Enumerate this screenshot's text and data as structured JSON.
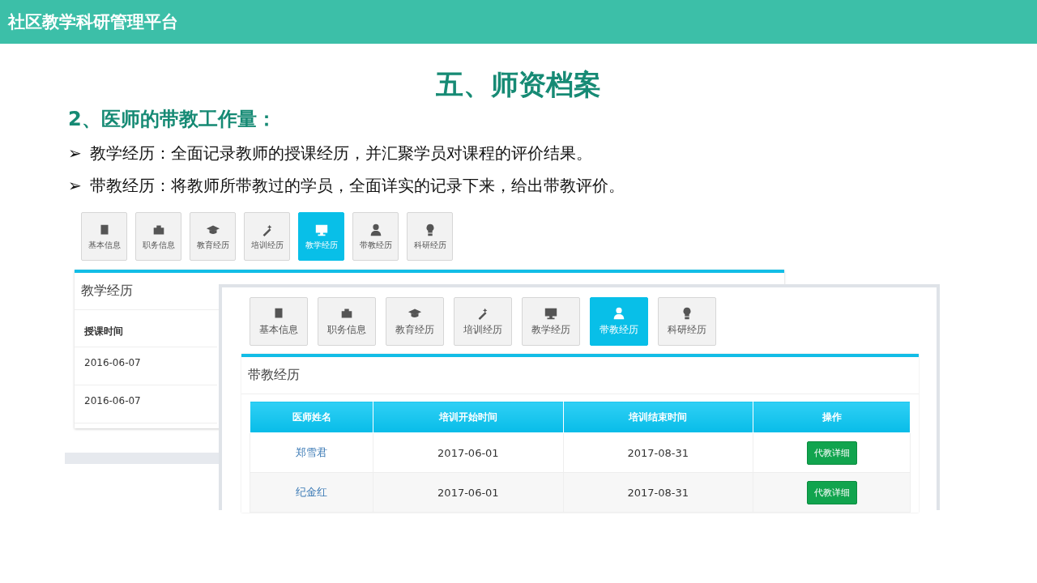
{
  "header": {
    "title": "社区教学科研管理平台"
  },
  "slide": {
    "title": "五、师资档案",
    "subtitle": "2、医师的带教工作量：",
    "bullets": [
      {
        "marker": "➢",
        "text": "教学经历：全面记录教师的授课经历，并汇聚学员对课程的评价结果。"
      },
      {
        "marker": "➢",
        "text": "带教经历：将教师所带教过的学员，全面详实的记录下来，给出带教评价。"
      }
    ]
  },
  "back_screen": {
    "tabs": [
      {
        "label": "基本信息",
        "selected": false
      },
      {
        "label": "职务信息",
        "selected": false
      },
      {
        "label": "教育经历",
        "selected": false
      },
      {
        "label": "培训经历",
        "selected": false
      },
      {
        "label": "教学经历",
        "selected": true
      },
      {
        "label": "带教经历",
        "selected": false
      },
      {
        "label": "科研经历",
        "selected": false
      }
    ],
    "panel_title": "教学经历",
    "column": "授课时间",
    "rows": [
      "2016-06-07",
      "2016-06-07"
    ]
  },
  "front_screen": {
    "tabs": [
      {
        "label": "基本信息",
        "selected": false
      },
      {
        "label": "职务信息",
        "selected": false
      },
      {
        "label": "教育经历",
        "selected": false
      },
      {
        "label": "培训经历",
        "selected": false
      },
      {
        "label": "教学经历",
        "selected": false
      },
      {
        "label": "带教经历",
        "selected": true
      },
      {
        "label": "科研经历",
        "selected": false
      }
    ],
    "panel_title": "带教经历",
    "columns": [
      "医师姓名",
      "培训开始时间",
      "培训结束时间",
      "操作"
    ],
    "rows": [
      {
        "name": "郑雪君",
        "start": "2017-06-01",
        "end": "2017-08-31",
        "action": "代教详细"
      },
      {
        "name": "纪金红",
        "start": "2017-06-01",
        "end": "2017-08-31",
        "action": "代教详细"
      }
    ]
  }
}
